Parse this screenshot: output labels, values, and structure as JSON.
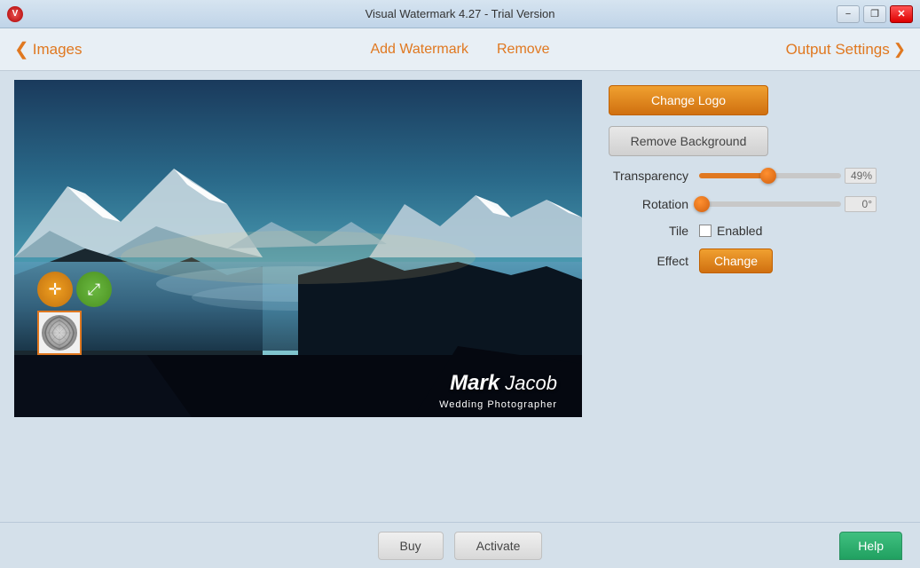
{
  "titleBar": {
    "title": "Visual Watermark 4.27 - Trial Version",
    "appIcon": "V",
    "controls": {
      "minimize": "−",
      "restore": "❐",
      "close": "✕"
    }
  },
  "navBar": {
    "backLabel": "Images",
    "backChevron": "❮",
    "centerLinks": [
      {
        "label": "Add Watermark",
        "id": "add-watermark"
      },
      {
        "label": "Remove",
        "id": "remove"
      }
    ],
    "rightLabel": "Output Settings",
    "rightChevron": "❯"
  },
  "rightPanel": {
    "changeLogoLabel": "Change Logo",
    "removeBackgroundLabel": "Remove Background",
    "controls": {
      "transparency": {
        "label": "Transparency",
        "value": 49,
        "displayValue": "49%",
        "fillPercent": 49
      },
      "rotation": {
        "label": "Rotation",
        "value": 0,
        "displayValue": "0°",
        "fillPercent": 0
      },
      "tile": {
        "label": "Tile",
        "checkboxChecked": false,
        "checkboxLabel": "Enabled"
      },
      "effect": {
        "label": "Effect",
        "buttonLabel": "Change"
      }
    }
  },
  "watermark": {
    "name": "Mark Jacob",
    "boldPart": "Mark",
    "subtitle": "Wedding Photographer"
  },
  "bottomBar": {
    "buyLabel": "Buy",
    "activateLabel": "Activate",
    "helpLabel": "Help"
  },
  "icons": {
    "move": "✛",
    "resize": "⤢",
    "chevronLeft": "❮",
    "chevronRight": "❯"
  }
}
